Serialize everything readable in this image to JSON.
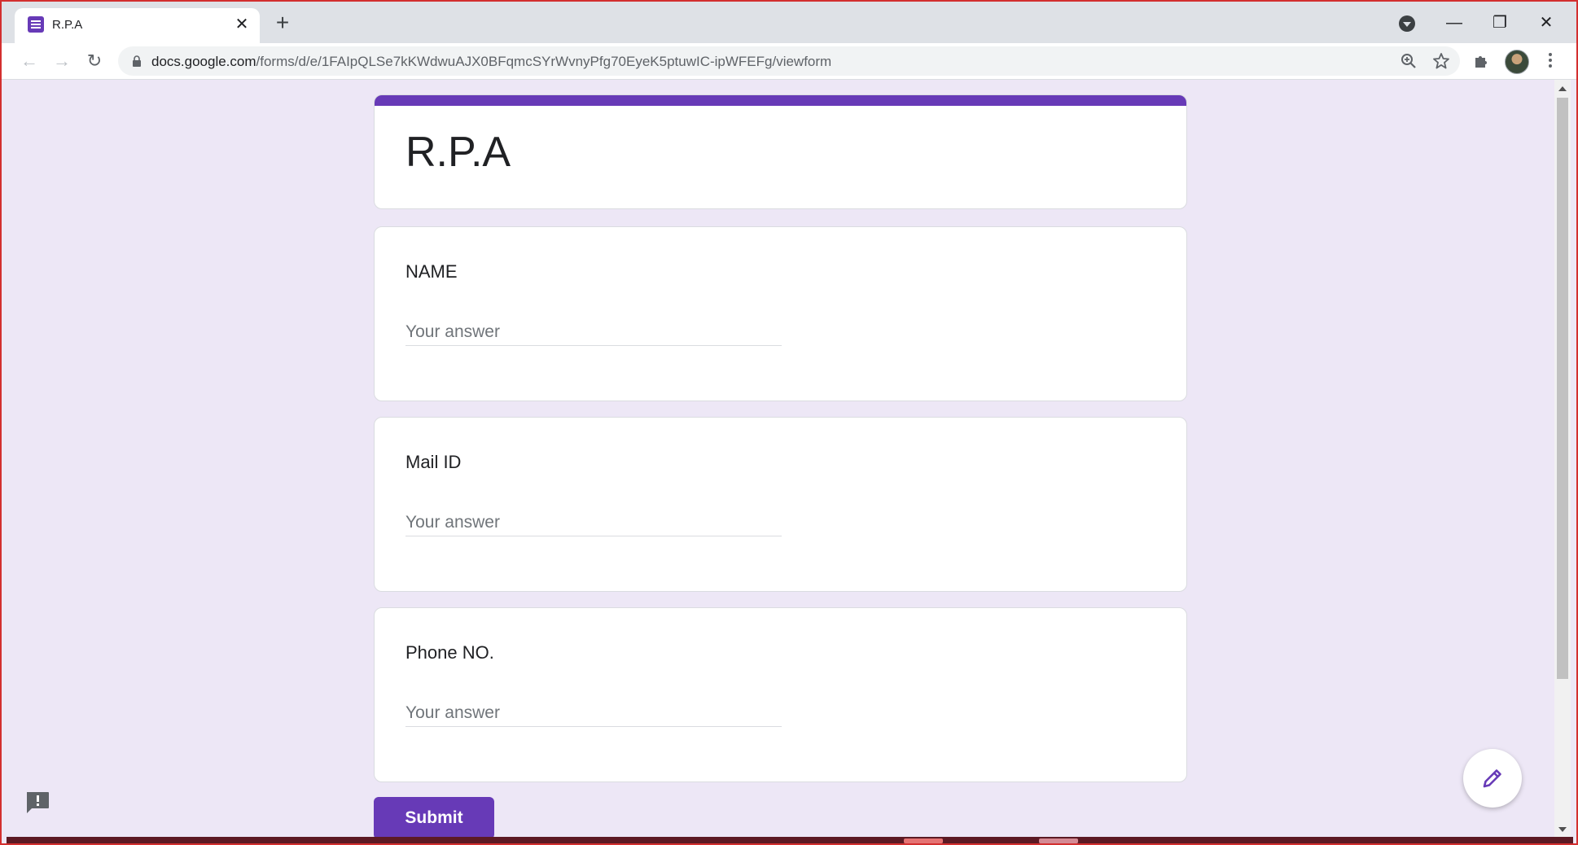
{
  "browser": {
    "tab": {
      "title": "R.P.A",
      "icon": "google-forms-icon"
    },
    "new_tab_label": "+",
    "url_host": "docs.google.com",
    "url_path": "/forms/d/e/1FAIpQLSe7kKWdwuAJX0BFqmcSYrWvnyPfg70EyeK5ptuwIC-ipWFEFg/viewform",
    "window_controls": {
      "minimize": "—",
      "restore": "❐",
      "close": "✕"
    }
  },
  "form": {
    "title": "R.P.A",
    "accent_color": "#673ab7",
    "background_color": "#ede7f6",
    "questions": [
      {
        "title": "NAME",
        "placeholder": "Your answer"
      },
      {
        "title": "Mail ID",
        "placeholder": "Your answer"
      },
      {
        "title": "Phone NO.",
        "placeholder": "Your answer"
      }
    ],
    "submit_label": "Submit"
  },
  "icons": {
    "report": "report-problem-icon",
    "edit_fab": "pencil-icon"
  }
}
